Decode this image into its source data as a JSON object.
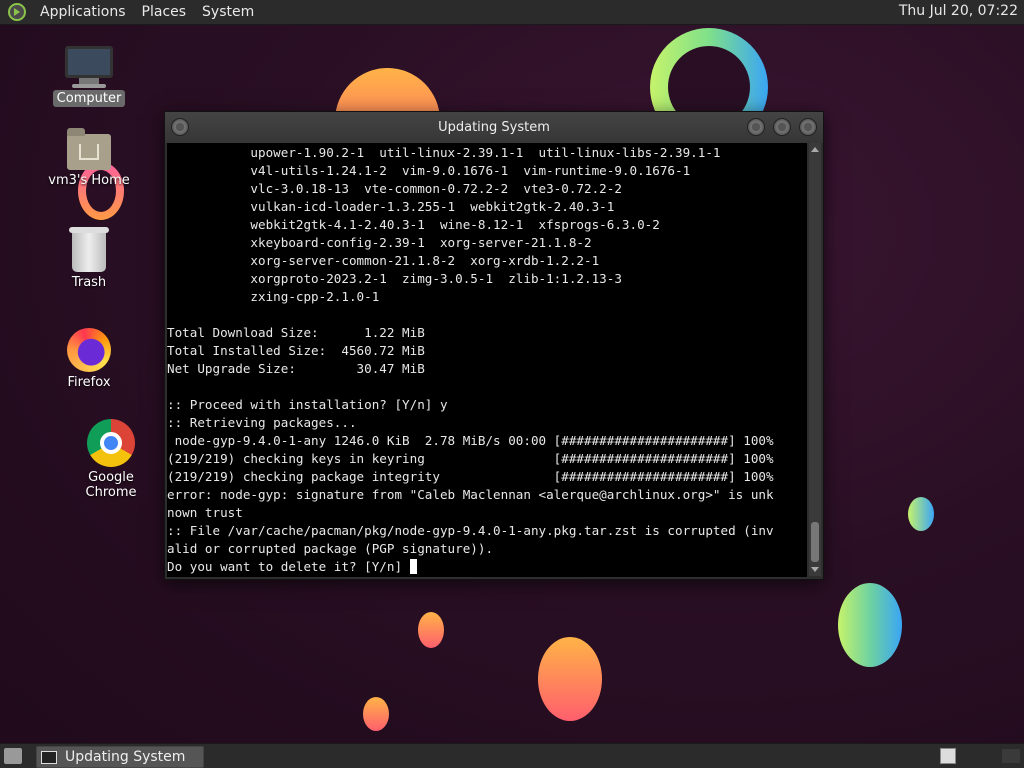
{
  "top_panel": {
    "menus": [
      "Applications",
      "Places",
      "System"
    ],
    "clock": "Thu Jul 20, 07:22"
  },
  "desktop_icons": {
    "computer": "Computer",
    "home": "vm3's Home",
    "trash": "Trash",
    "firefox": "Firefox",
    "chrome": "Google Chrome"
  },
  "window": {
    "title": "Updating System",
    "lines": [
      "           upower-1.90.2-1  util-linux-2.39.1-1  util-linux-libs-2.39.1-1",
      "           v4l-utils-1.24.1-2  vim-9.0.1676-1  vim-runtime-9.0.1676-1",
      "           vlc-3.0.18-13  vte-common-0.72.2-2  vte3-0.72.2-2",
      "           vulkan-icd-loader-1.3.255-1  webkit2gtk-2.40.3-1",
      "           webkit2gtk-4.1-2.40.3-1  wine-8.12-1  xfsprogs-6.3.0-2",
      "           xkeyboard-config-2.39-1  xorg-server-21.1.8-2",
      "           xorg-server-common-21.1.8-2  xorg-xrdb-1.2.2-1",
      "           xorgproto-2023.2-1  zimg-3.0.5-1  zlib-1:1.2.13-3",
      "           zxing-cpp-2.1.0-1",
      "",
      "Total Download Size:      1.22 MiB",
      "Total Installed Size:  4560.72 MiB",
      "Net Upgrade Size:        30.47 MiB",
      "",
      ":: Proceed with installation? [Y/n] y",
      ":: Retrieving packages...",
      " node-gyp-9.4.0-1-any 1246.0 KiB  2.78 MiB/s 00:00 [######################] 100%",
      "(219/219) checking keys in keyring                 [######################] 100%",
      "(219/219) checking package integrity               [######################] 100%",
      "error: node-gyp: signature from \"Caleb Maclennan <alerque@archlinux.org>\" is unk",
      "nown trust",
      ":: File /var/cache/pacman/pkg/node-gyp-9.4.0-1-any.pkg.tar.zst is corrupted (inv",
      "alid or corrupted package (PGP signature)).",
      "Do you want to delete it? [Y/n] "
    ]
  },
  "taskbar": {
    "task_label": "Updating System"
  }
}
